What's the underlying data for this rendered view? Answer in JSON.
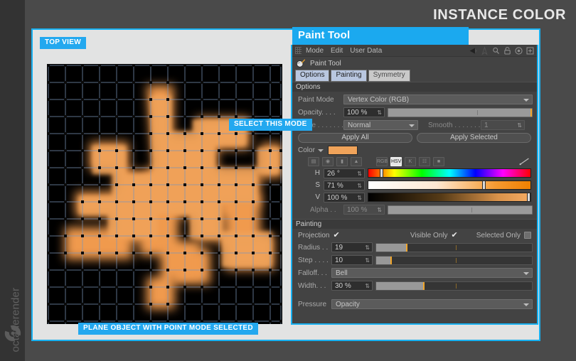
{
  "page": {
    "title": "INSTANCE COLOR",
    "watermark": "octanerender"
  },
  "viewport": {
    "top_view_badge": "TOP VIEW",
    "plane_badge": "PLANE OBJECT WITH POINT MODE SELECTED",
    "select_mode_badge": "SELECT THIS MODE"
  },
  "paint_tool": {
    "window_title": "Paint Tool",
    "menu": [
      "Mode",
      "Edit",
      "User Data"
    ],
    "menu_icons": [
      "arrow-left-icon",
      "cursor-icon",
      "magnifier-icon",
      "lock-icon",
      "target-icon",
      "plus-box-icon"
    ],
    "tool_header": "Paint Tool",
    "tabs": [
      {
        "label": "Options",
        "selected": true
      },
      {
        "label": "Painting",
        "selected": true
      },
      {
        "label": "Symmetry",
        "selected": false
      }
    ],
    "options": {
      "section_label": "Options",
      "paint_mode": {
        "label": "Paint Mode",
        "value": "Vertex Color (RGB)"
      },
      "opacity": {
        "label": "Opacity. . . .",
        "value": "100 %"
      },
      "mode": {
        "label": "Mode . . . . . . . . . .",
        "value": "Normal"
      },
      "smooth": {
        "label": "Smooth . . . . . . . .",
        "value": "1"
      },
      "apply_all": "Apply All",
      "apply_selected": "Apply Selected",
      "color": {
        "label": "Color",
        "swatch_hex": "#f0a35a",
        "mode_buttons": [
          "sliders-icon",
          "wheel-icon",
          "gradient-icon",
          "picture-icon"
        ],
        "space_buttons": [
          "RGB",
          "HSV",
          "K",
          "mixer-icon",
          "swatches-icon"
        ],
        "active_space": "HSV",
        "eyedropper": "eyedropper-icon",
        "channels": [
          {
            "name": "H",
            "value": "26 °",
            "knob_pct": 7
          },
          {
            "name": "S",
            "value": "71 %",
            "knob_pct": 71
          },
          {
            "name": "V",
            "value": "100 %",
            "knob_pct": 100
          }
        ],
        "alpha": {
          "label": "Alpha . .",
          "value": "100 %"
        }
      }
    },
    "painting": {
      "section_label": "Painting",
      "projection": {
        "label": "Projection",
        "checked": true
      },
      "visible_only": {
        "label": "Visible Only",
        "checked": true
      },
      "selected_only": {
        "label": "Selected Only",
        "checked": false
      },
      "radius": {
        "label": "Radius . .",
        "value": "19",
        "fill_pct": 19
      },
      "step": {
        "label": "Step . . . .",
        "value": "10",
        "fill_pct": 9
      },
      "falloff": {
        "label": "Falloff. . .",
        "value": "Bell"
      },
      "width": {
        "label": "Width. . .",
        "value": "30 %",
        "fill_pct": 30
      },
      "pressure": {
        "label": "Pressure",
        "value": "Opacity"
      }
    }
  },
  "colors": {
    "accent_blue": "#1ba9ef",
    "panel_bg": "#434343",
    "page_bg": "#4a4a4a",
    "paint_orange": "#f0a35a"
  }
}
